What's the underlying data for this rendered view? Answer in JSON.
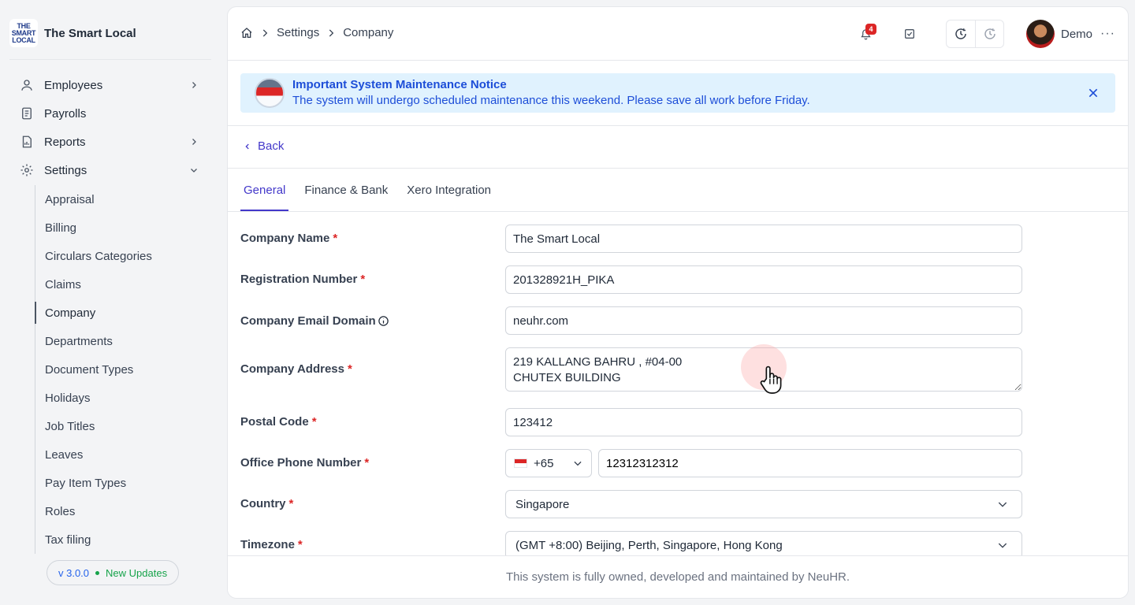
{
  "brand": {
    "logo_lines": [
      "THE",
      "SMART",
      "LOCAL"
    ],
    "name": "The Smart Local"
  },
  "sidebar": {
    "items": [
      {
        "label": "Employees",
        "icon": "user-icon",
        "has_chevron": "right"
      },
      {
        "label": "Payrolls",
        "icon": "document-icon"
      },
      {
        "label": "Reports",
        "icon": "chart-file-icon",
        "has_chevron": "right"
      },
      {
        "label": "Settings",
        "icon": "gear-icon",
        "has_chevron": "down"
      }
    ],
    "settings_subitems": [
      "Appraisal",
      "Billing",
      "Circulars Categories",
      "Claims",
      "Company",
      "Departments",
      "Document Types",
      "Holidays",
      "Job Titles",
      "Leaves",
      "Pay Item Types",
      "Roles",
      "Tax filing"
    ],
    "active_subitem": "Company",
    "version": "v 3.0.0",
    "updates": "New Updates"
  },
  "topbar": {
    "breadcrumbs": [
      "Settings",
      "Company"
    ],
    "notification_count": "4",
    "user_name": "Demo",
    "more": "···"
  },
  "notice": {
    "title": "Important System Maintenance Notice",
    "text": "The system will undergo scheduled maintenance this weekend. Please save all work before Friday."
  },
  "back_label": "Back",
  "tabs": [
    "General",
    "Finance & Bank",
    "Xero Integration"
  ],
  "active_tab": "General",
  "form": {
    "company_name": {
      "label": "Company Name",
      "value": "The Smart Local"
    },
    "registration_number": {
      "label": "Registration Number",
      "value": "201328921H_PIKA"
    },
    "email_domain": {
      "label": "Company Email Domain",
      "value": "neuhr.com"
    },
    "address": {
      "label": "Company Address",
      "value": "219 KALLANG BAHRU , #04-00\nCHUTEX BUILDING"
    },
    "postal_code": {
      "label": "Postal Code",
      "value": "123412"
    },
    "office_phone": {
      "label": "Office Phone Number",
      "code": "+65",
      "value": "12312312312"
    },
    "country": {
      "label": "Country",
      "value": "Singapore"
    },
    "timezone": {
      "label": "Timezone",
      "value": "(GMT +8:00) Beijing, Perth, Singapore, Hong Kong"
    },
    "required_mark": "*"
  },
  "footer": "This system is fully owned, developed and maintained by NeuHR.",
  "colors": {
    "accent": "#4338ca",
    "notice_bg": "#e0f2fe",
    "notice_text": "#1d4ed8",
    "required": "#dc2626",
    "badge": "#dc2626"
  }
}
